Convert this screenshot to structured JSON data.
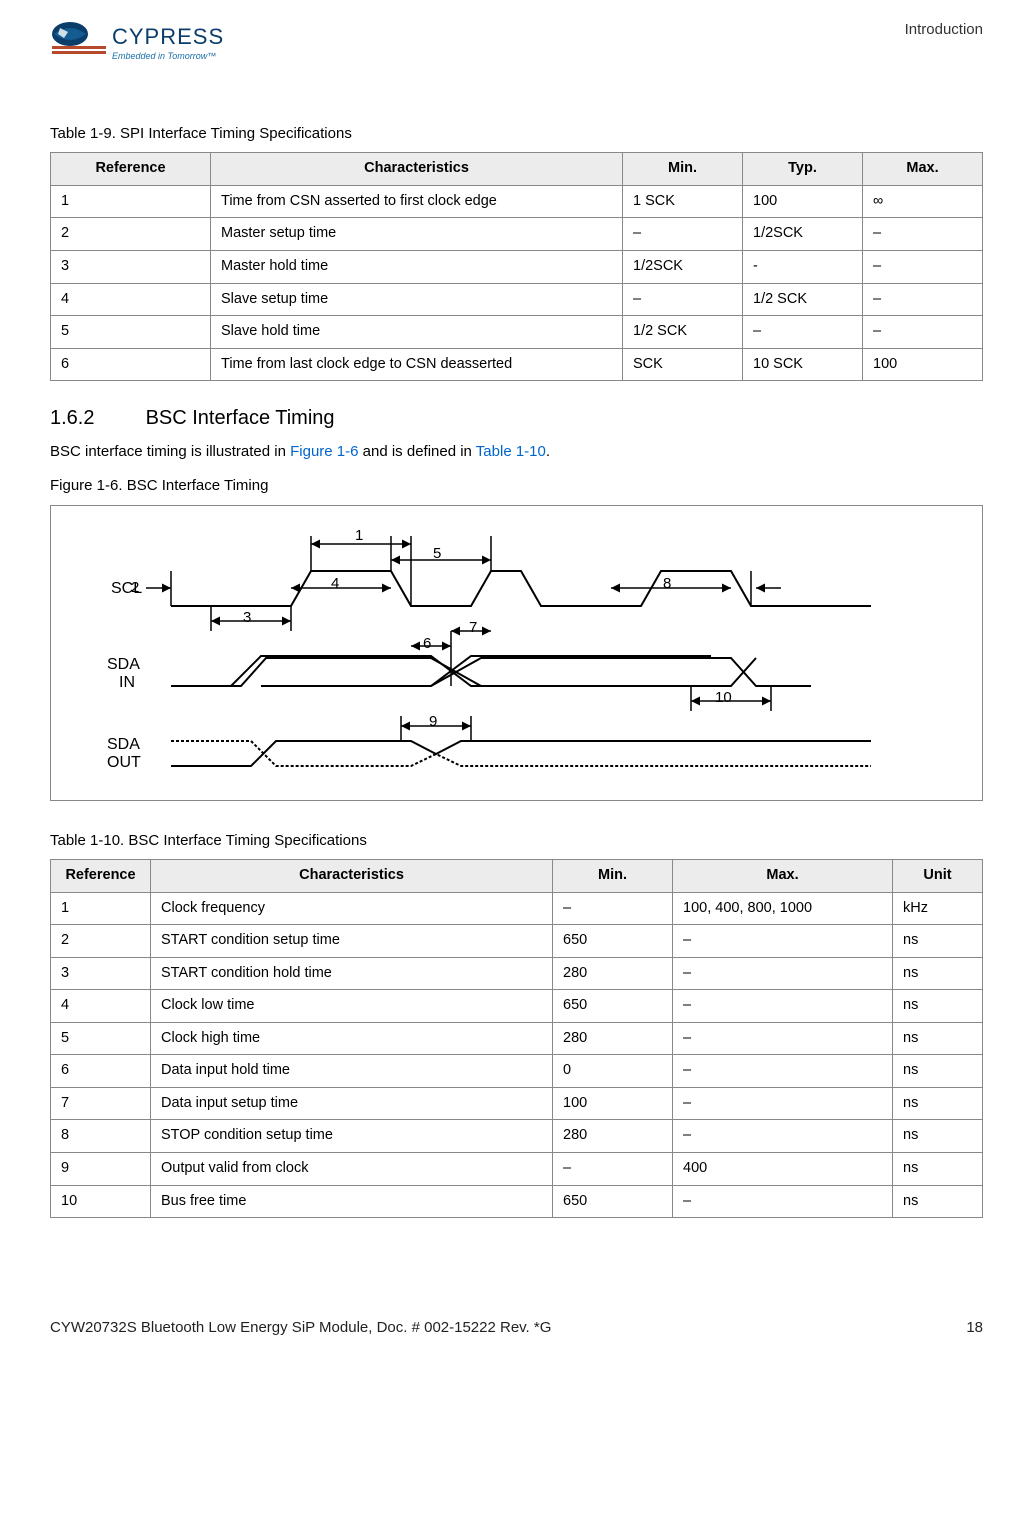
{
  "header": {
    "brand_name": "CYPRESS",
    "brand_tagline": "Embedded in Tomorrow™",
    "section": "Introduction"
  },
  "table19": {
    "caption": "Table 1-9.  SPI Interface Timing Specifications",
    "headers": [
      "Reference",
      "Characteristics",
      "Min.",
      "Typ.",
      "Max."
    ],
    "rows": [
      [
        "1",
        "Time from CSN asserted to first clock edge",
        "1 SCK",
        "100",
        "∞"
      ],
      [
        "2",
        "Master setup time",
        "–",
        "1/2SCK",
        "–"
      ],
      [
        "3",
        "Master hold time",
        "1/2SCK",
        "-",
        "–"
      ],
      [
        "4",
        "Slave setup time",
        "–",
        "1/2 SCK",
        "–"
      ],
      [
        "5",
        "Slave hold time",
        "1/2 SCK",
        "–",
        "–"
      ],
      [
        "6",
        "Time from last clock edge to CSN deasserted",
        "SCK",
        "10 SCK",
        "100"
      ]
    ]
  },
  "subsection": {
    "number": "1.6.2",
    "title": "BSC Interface Timing",
    "intro_pre": "BSC interface timing is illustrated in ",
    "link1": "Figure 1-6",
    "intro_mid": " and is defined in ",
    "link2": "Table 1-10",
    "intro_post": "."
  },
  "figure": {
    "caption": "Figure 1-6.  BSC Interface Timing",
    "labels": {
      "scl": "SCL",
      "sda_in_1": "SDA",
      "sda_in_2": "IN",
      "sda_out_1": "SDA",
      "sda_out_2": "OUT",
      "n1": "1",
      "n2": "2",
      "n3": "3",
      "n4": "4",
      "n5": "5",
      "n6": "6",
      "n7": "7",
      "n8": "8",
      "n9": "9",
      "n10": "10"
    }
  },
  "table110": {
    "caption": "Table 1-10.  BSC Interface Timing Specifications",
    "headers": [
      "Reference",
      "Characteristics",
      "Min.",
      "Max.",
      "Unit"
    ],
    "rows": [
      [
        "1",
        "Clock frequency",
        "–",
        "100, 400, 800, 1000",
        "kHz"
      ],
      [
        "2",
        "START condition setup time",
        "650",
        "–",
        "ns"
      ],
      [
        "3",
        "START condition hold time",
        "280",
        "–",
        "ns"
      ],
      [
        "4",
        "Clock low time",
        "650",
        "–",
        "ns"
      ],
      [
        "5",
        "Clock high time",
        "280",
        "–",
        "ns"
      ],
      [
        "6",
        "Data input hold time",
        "0",
        "–",
        "ns"
      ],
      [
        "7",
        "Data input setup time",
        "100",
        "–",
        "ns"
      ],
      [
        "8",
        "STOP condition setup time",
        "280",
        "–",
        "ns"
      ],
      [
        "9",
        "Output valid from clock",
        "–",
        "400",
        "ns"
      ],
      [
        "10",
        "Bus free time",
        "650",
        "–",
        "ns"
      ]
    ]
  },
  "footer": {
    "doc": "CYW20732S Bluetooth Low Energy SiP Module, Doc. # 002-15222 Rev. *G",
    "page": "18"
  }
}
